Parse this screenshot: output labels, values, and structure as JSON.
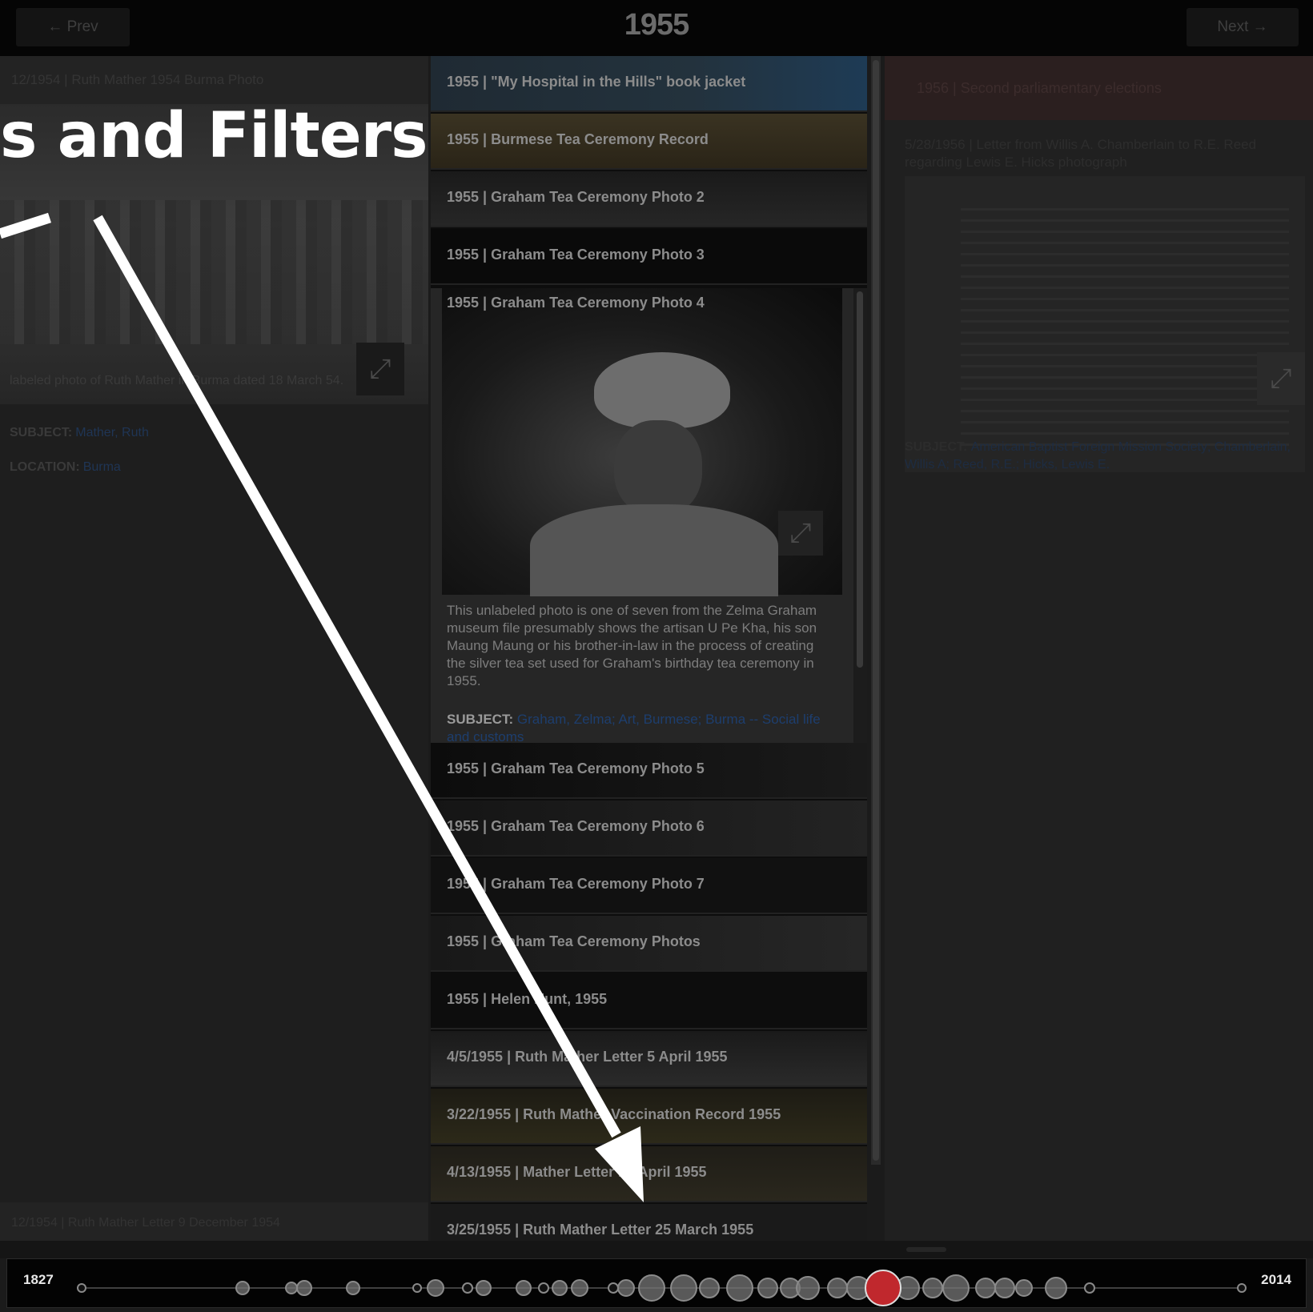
{
  "header": {
    "prev_label": "← Prev",
    "next_label": "Next →",
    "year": "1955"
  },
  "left_panel": {
    "title": "12/1954 | Ruth Mather 1954 Burma Photo",
    "caption": "labeled photo of Ruth Mather in Burma dated 18 March 54.",
    "subject_label": "SUBJECT:",
    "subject_value": "Mather, Ruth",
    "location_label": "LOCATION:",
    "location_value": "Burma",
    "footer": "12/1954 | Ruth Mather Letter 9 December 1954"
  },
  "list": {
    "items_before": [
      "1955 | \"My Hospital in the Hills\" book jacket",
      "1955 | Burmese Tea Ceremony Record",
      "1955 | Graham Tea Ceremony Photo 2",
      "1955 | Graham Tea Ceremony Photo 3"
    ],
    "expanded": {
      "title": "1955 | Graham Tea Ceremony Photo 4",
      "description": "This unlabeled photo is one of seven from the Zelma Graham museum file presumably shows the artisan U Pe Kha, his son Maung Maung or his brother-in-law in the process of creating the silver tea set used for Graham's birthday tea ceremony in 1955.",
      "subject_label": "SUBJECT:",
      "subject_value": "Graham, Zelma; Art, Burmese; Burma -- Social life and customs"
    },
    "items_after": [
      "1955 | Graham Tea Ceremony Photo 5",
      "1955 | Graham Tea Ceremony Photo 6",
      "1955 | Graham Tea Ceremony Photo 7",
      "1955 | Graham Tea Ceremony Photos",
      "1955 | Helen Hunt, 1955",
      "4/5/1955 | Ruth Mather Letter 5 April 1955",
      "3/22/1955 | Ruth Mather Vaccination Record 1955",
      "4/13/1955 | Mather Letter 13 April 1955",
      "3/25/1955 | Ruth Mather Letter 25 March 1955"
    ]
  },
  "right_panel": {
    "banner": "1956 | Second parliamentary elections",
    "title": "5/28/1956 | Letter from Willis A. Chamberlain to R.E. Reed regarding Lewis E. Hicks photograph",
    "subject_label": "SUBJECT:",
    "subject_value": "American Baptist Foreign Mission Society; Chamberlain, Willis A; Reed, R.E.; Hicks, Lewis E."
  },
  "timeline": {
    "start_label": "1827",
    "end_label": "2014",
    "accent_color": "#c0282d",
    "node_color": "#8a8a8a"
  },
  "annotation": {
    "heading": "s and Filters",
    "color": "#ffffff"
  },
  "icons": {
    "expand": "expand-arrows-icon"
  }
}
